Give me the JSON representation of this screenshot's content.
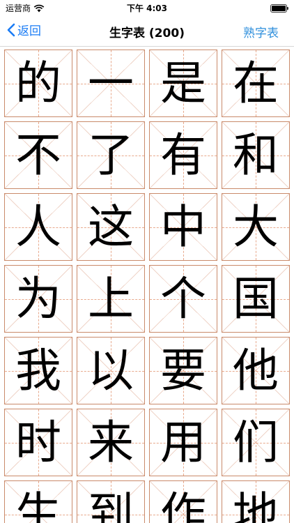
{
  "status_bar": {
    "carrier": "运营商",
    "time": "下午 4:03"
  },
  "nav": {
    "back_label": "返回",
    "title": "生字表 (200)",
    "right_label": "熟字表"
  },
  "characters": [
    "的",
    "一",
    "是",
    "在",
    "不",
    "了",
    "有",
    "和",
    "人",
    "这",
    "中",
    "大",
    "为",
    "上",
    "个",
    "国",
    "我",
    "以",
    "要",
    "他",
    "时",
    "来",
    "用",
    "们",
    "生",
    "到",
    "作",
    "地"
  ],
  "colors": {
    "accent": "#1a7cf5",
    "grid_border": "#c98a6a",
    "guide": "#e8a98c"
  }
}
